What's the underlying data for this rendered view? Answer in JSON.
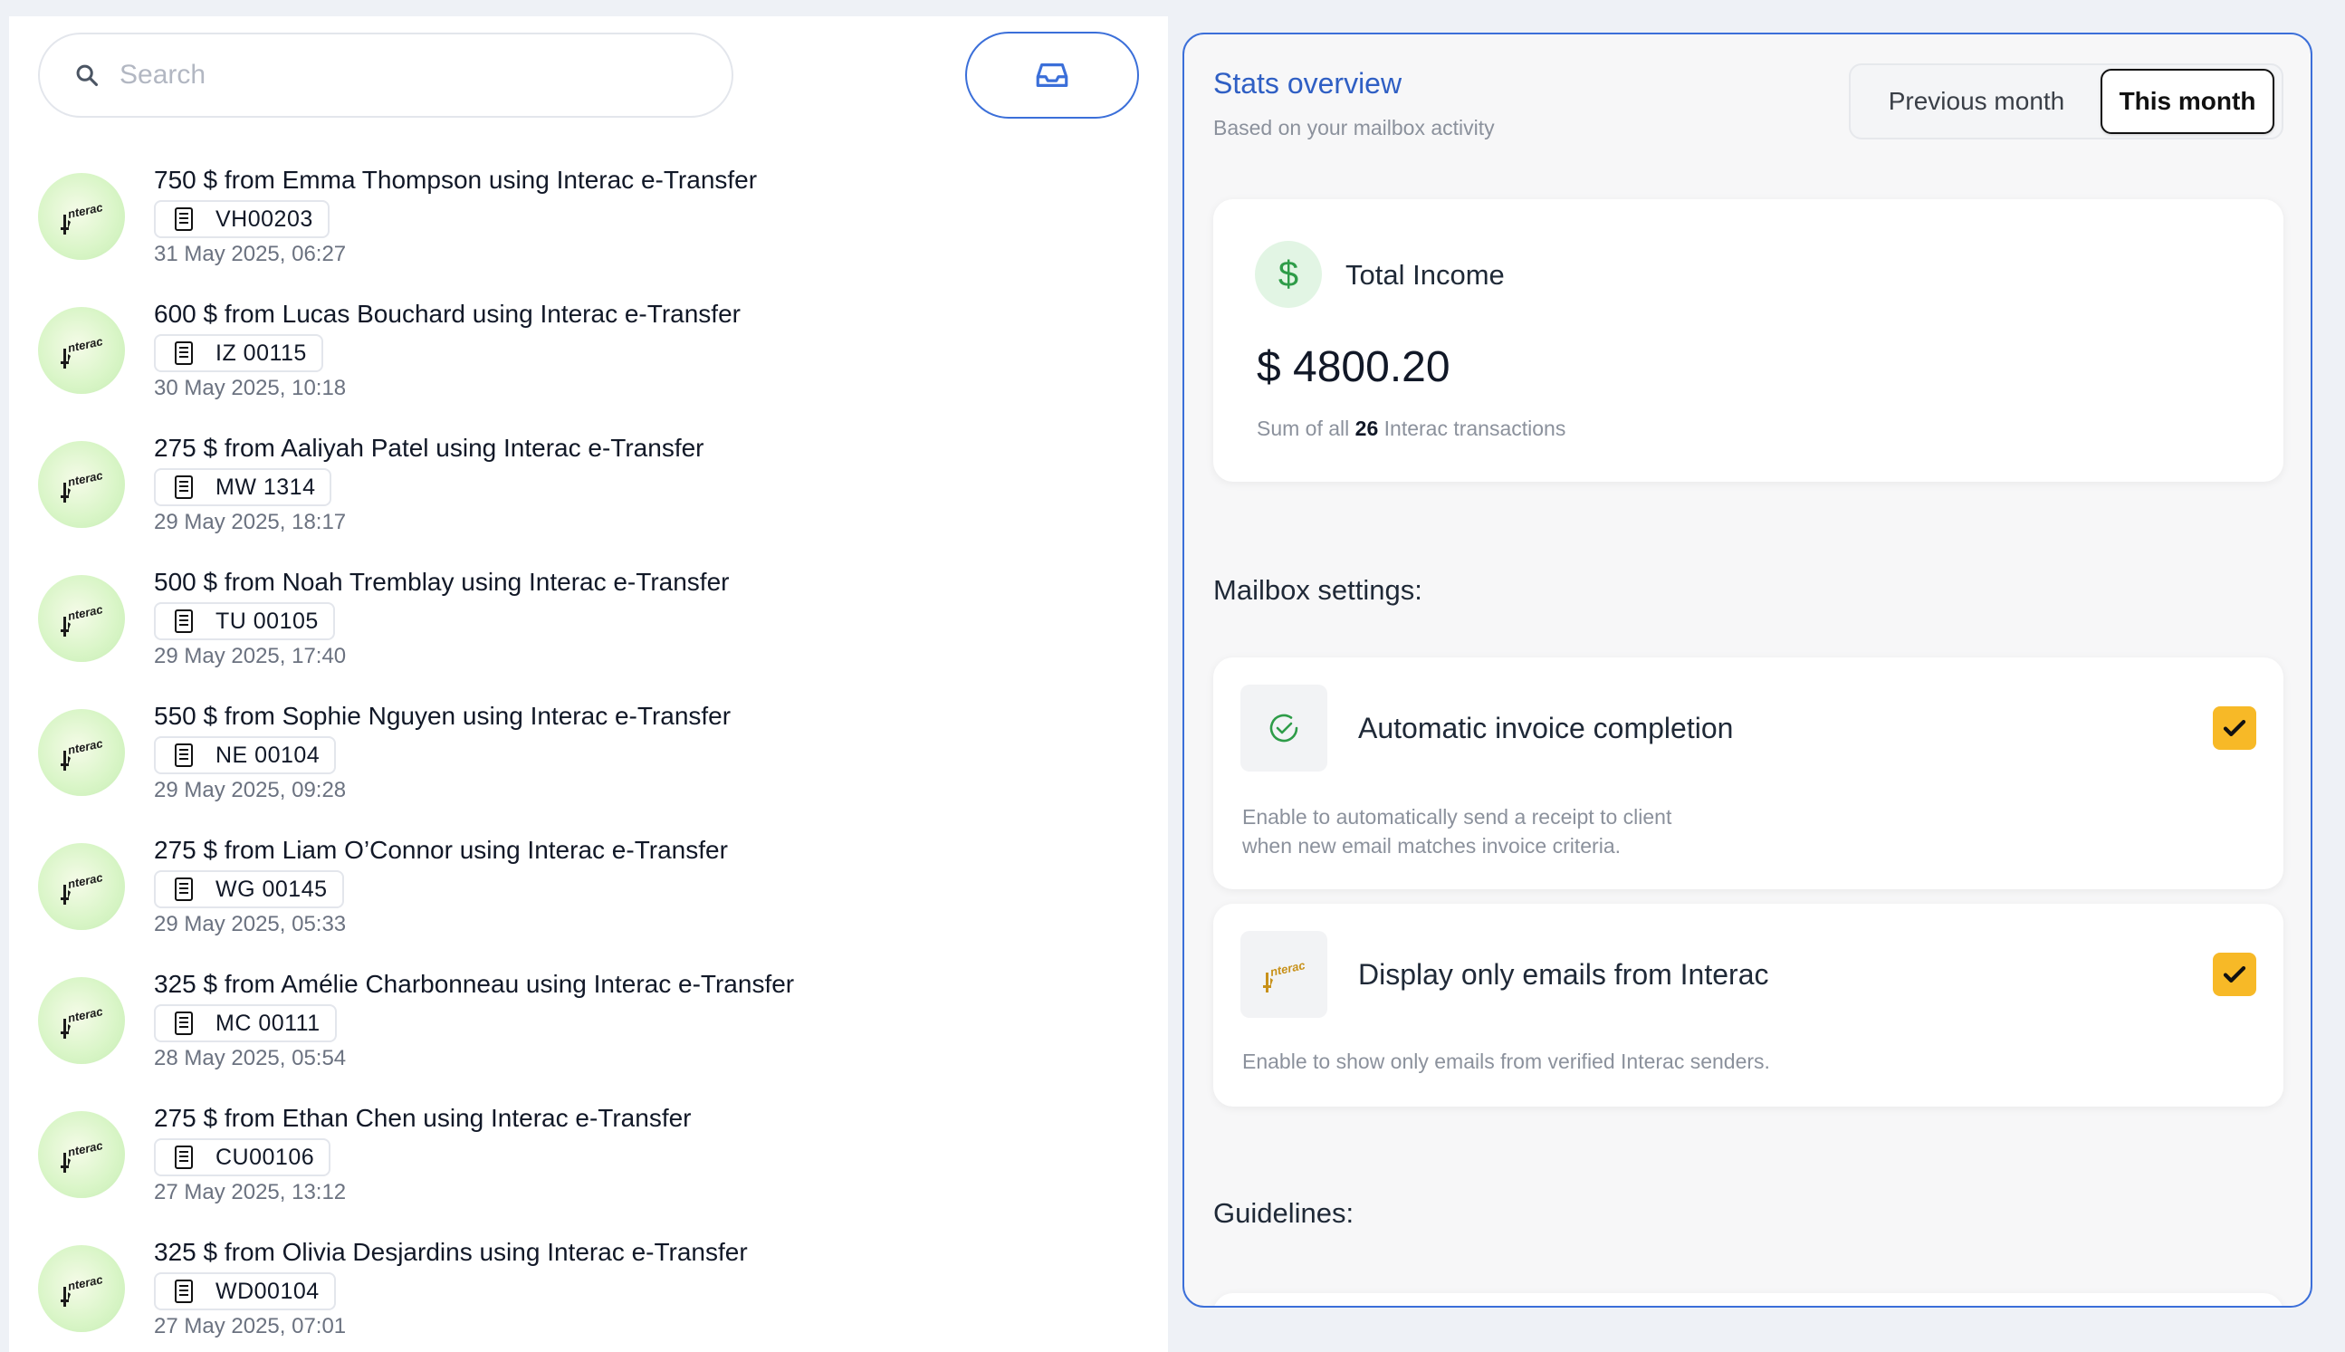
{
  "search": {
    "placeholder": "Search"
  },
  "transactions": [
    {
      "title": "750 $ from Emma Thompson using Interac e-Transfer",
      "ref": "VH00203",
      "date": "31 May 2025, 06:27"
    },
    {
      "title": "600 $ from Lucas Bouchard using Interac e-Transfer",
      "ref": "IZ 00115",
      "date": "30 May 2025, 10:18"
    },
    {
      "title": "275 $ from Aaliyah Patel using Interac e-Transfer",
      "ref": "MW 1314",
      "date": "29 May 2025, 18:17"
    },
    {
      "title": "500 $ from Noah Tremblay using Interac e-Transfer",
      "ref": "TU 00105",
      "date": "29 May 2025, 17:40"
    },
    {
      "title": "550 $ from Sophie Nguyen using Interac e-Transfer",
      "ref": "NE 00104",
      "date": "29 May 2025, 09:28"
    },
    {
      "title": "275 $ from Liam O’Connor using Interac e-Transfer",
      "ref": "WG 00145",
      "date": "29 May 2025, 05:33"
    },
    {
      "title": "325 $ from Amélie Charbonneau using Interac e-Transfer",
      "ref": "MC 00111",
      "date": "28 May 2025, 05:54"
    },
    {
      "title": "275 $ from Ethan Chen using Interac e-Transfer",
      "ref": "CU00106",
      "date": "27 May 2025, 13:12"
    },
    {
      "title": "325 $ from Olivia Desjardins using Interac e-Transfer",
      "ref": "WD00104",
      "date": "27 May 2025, 07:01"
    }
  ],
  "stats": {
    "title": "Stats overview",
    "subtitle": "Based on your mailbox activity",
    "tabs": {
      "previous": "Previous month",
      "current": "This month"
    },
    "income": {
      "label": "Total Income",
      "value": "$ 4800.20",
      "note_prefix": "Sum of all",
      "count": "26",
      "note_suffix": "Interac transactions"
    }
  },
  "mailbox": {
    "heading": "Mailbox settings:",
    "settings": [
      {
        "title": "Automatic invoice completion",
        "desc_line1": "Enable to automatically send a receipt to client",
        "desc_line2": "when new email matches invoice criteria.",
        "checked": true
      },
      {
        "title": "Display only emails from Interac",
        "desc_line1": "Enable to show only emails from verified Interac senders.",
        "checked": true
      }
    ]
  },
  "guidelines": {
    "heading": "Guidelines:"
  },
  "colors": {
    "accent": "#3b6fd9",
    "checkbox": "#f7b927",
    "income_green": "#2e9c48"
  },
  "icons": {
    "search": "search-icon",
    "inbox": "inbox-icon",
    "receipt": "receipt-icon",
    "interac": "interac-logo-icon",
    "check_circle": "check-circle-icon",
    "checkmark": "checkmark-icon",
    "dollar": "dollar-icon"
  }
}
